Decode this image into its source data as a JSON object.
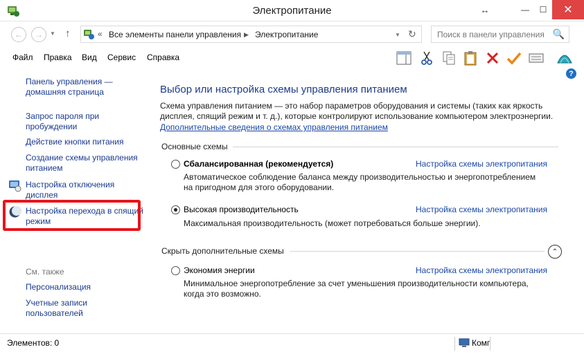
{
  "window": {
    "title": "Электропитание",
    "resize_glyph": "↔",
    "minimize_glyph": "—",
    "maximize_glyph": "☐",
    "close_glyph": "✕"
  },
  "address": {
    "back_glyph": "←",
    "forward_glyph": "→",
    "up_glyph": "↑",
    "prefix": "«",
    "crumbs": [
      "Все элементы панели управления",
      "Электропитание"
    ],
    "separator": "▶",
    "dropdown_glyph": "▼",
    "refresh_glyph": "↻",
    "search_placeholder": "Поиск в панели управления",
    "search_glyph": "🔍"
  },
  "menu": {
    "items": [
      {
        "label": "Файл"
      },
      {
        "label": "Правка"
      },
      {
        "label": "Вид"
      },
      {
        "label": "Сервис"
      },
      {
        "label": "Справка"
      }
    ],
    "toolbar_icons": [
      "layout-icon",
      "cut-icon",
      "copy-icon",
      "paste-icon",
      "delete-icon",
      "checkmark-icon",
      "keyboard-icon",
      "shell-icon"
    ]
  },
  "help": {
    "glyph": "?"
  },
  "sidebar": {
    "links": [
      {
        "label": "Панель управления — домашняя страница"
      },
      {
        "label": "Запрос пароля при пробуждении"
      },
      {
        "label": "Действие кнопки питания"
      },
      {
        "label": "Создание схемы управления питанием"
      },
      {
        "label": "Настройка отключения дисплея"
      },
      {
        "label": "Настройка перехода в спящий режим"
      }
    ],
    "see_also": "См. также",
    "see_also_links": [
      {
        "label": "Персонализация"
      },
      {
        "label": "Учетные записи пользователей"
      }
    ]
  },
  "main": {
    "title": "Выбор или настройка схемы управления питанием",
    "description": "Схема управления питанием — это набор параметров оборудования и системы (таких как яркость дисплея, спящий режим и т. д.), которые контролируют использование компьютером электроэнергии.",
    "more_link": "Дополнительные сведения о схемах управления питанием",
    "group1_title": "Основные схемы",
    "group2_title": "Скрыть дополнительные схемы",
    "collapse_glyph": "⌃",
    "plans": [
      {
        "name": "Сбалансированная (рекомендуется)",
        "selected": false,
        "link": "Настройка схемы электропитания",
        "description": "Автоматическое соблюдение баланса между производительностью и энергопотреблением на пригодном для этого оборудовании."
      },
      {
        "name": "Высокая производительность",
        "selected": true,
        "link": "Настройка схемы электропитания",
        "description": "Максимальная производительность (может потребоваться больше энергии)."
      },
      {
        "name": "Экономия энергии",
        "selected": false,
        "link": "Настройка схемы электропитания",
        "description": "Минимальное энергопотребление за счет уменьшения производительности компьютера, когда это возможно."
      }
    ]
  },
  "status": {
    "left": "Элементов: 0",
    "right": "Компьютер"
  }
}
